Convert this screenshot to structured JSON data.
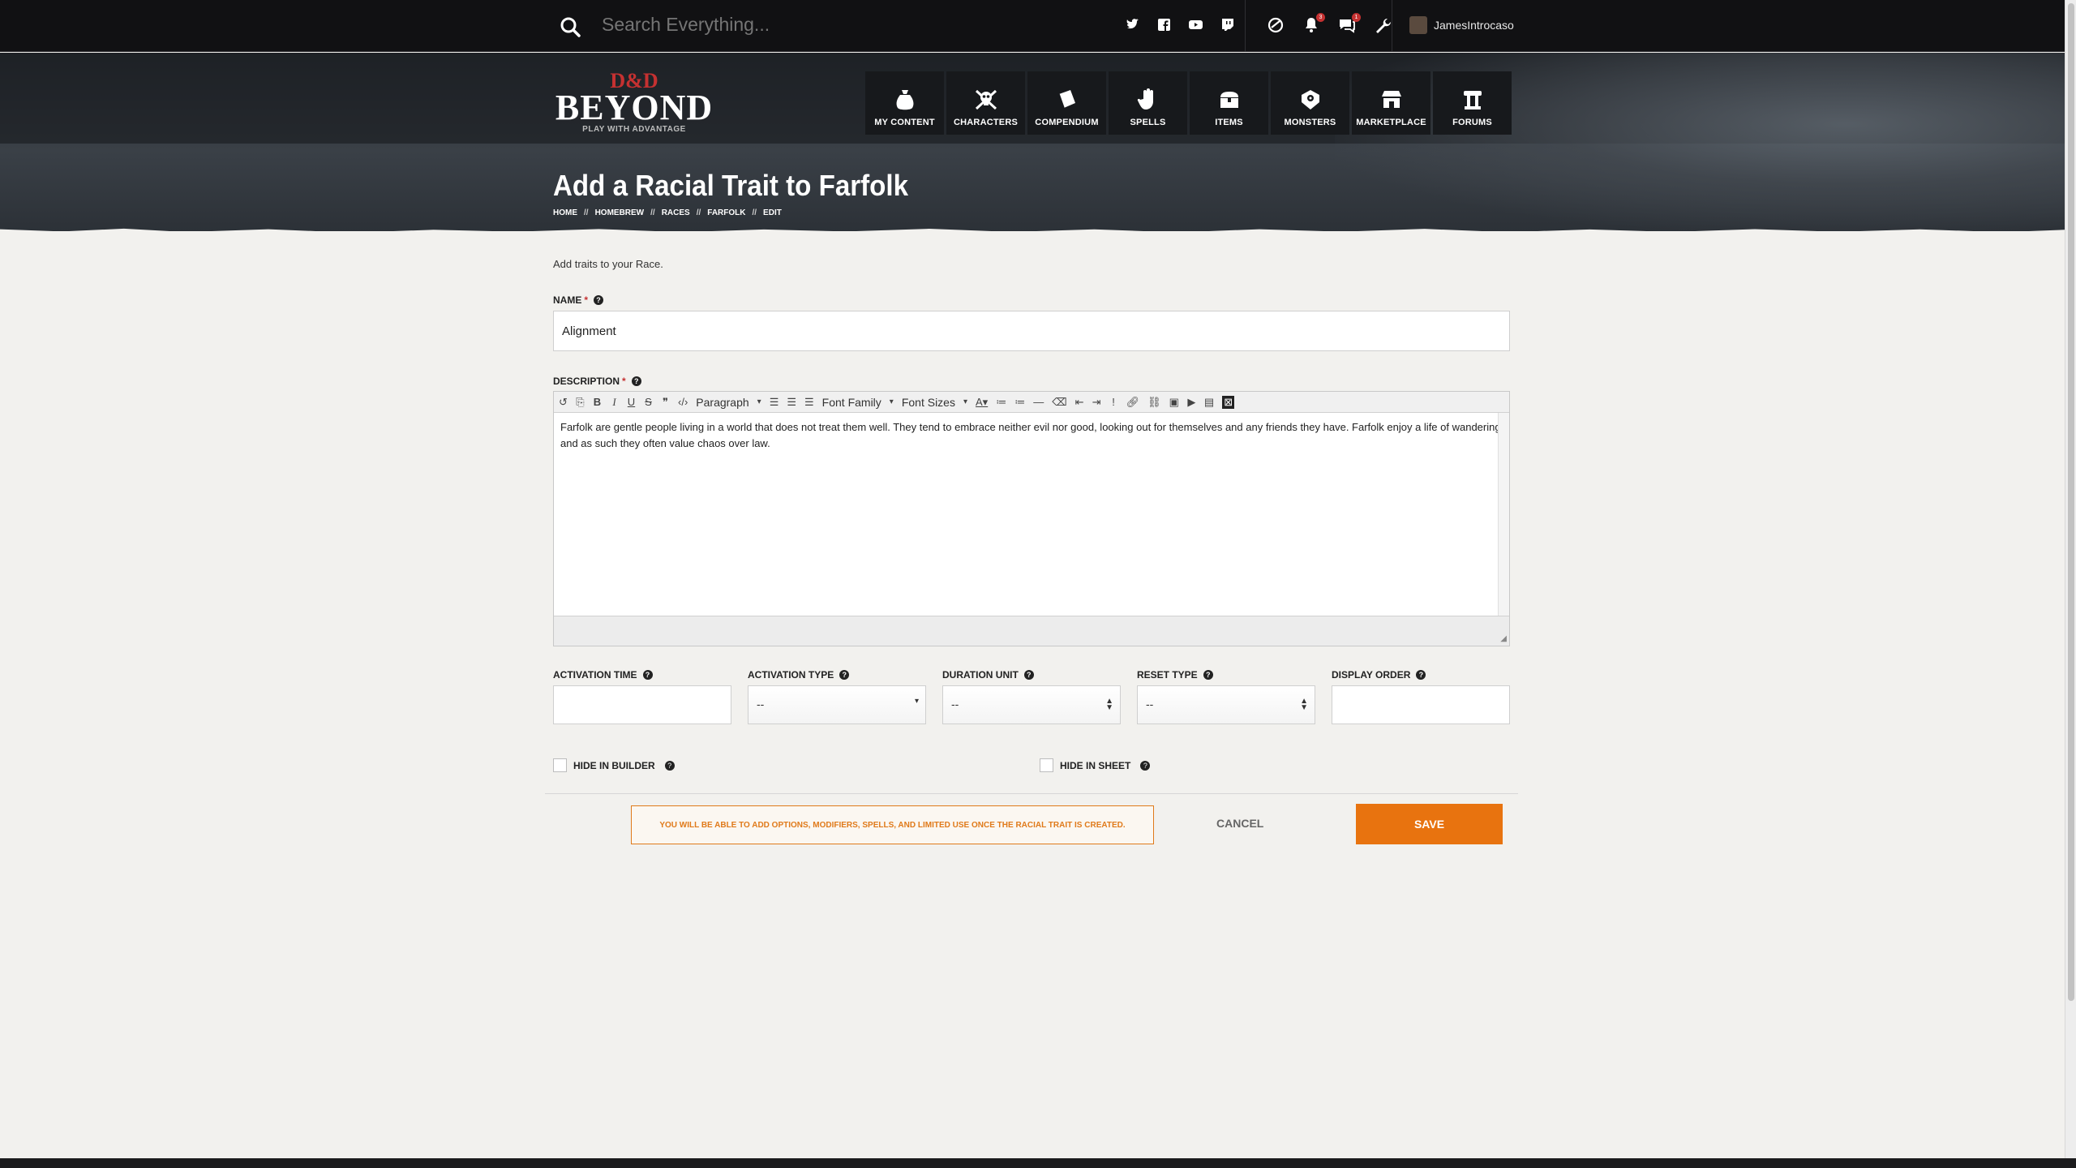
{
  "search": {
    "placeholder": "Search Everything..."
  },
  "social_icons": [
    "twitter-icon",
    "facebook-icon",
    "youtube-icon",
    "twitch-icon"
  ],
  "top_icons": [
    "dnd-icon",
    "notifications-icon",
    "messages-icon",
    "wrench-icon"
  ],
  "notifications": {
    "badge": "3"
  },
  "messages": {
    "badge": "1"
  },
  "user": {
    "name": "JamesIntrocaso"
  },
  "logo": {
    "dd": "D&D",
    "beyond": "BEYOND",
    "tagline": "PLAY WITH ADVANTAGE"
  },
  "nav": [
    {
      "label": "MY CONTENT",
      "icon": "bag-icon"
    },
    {
      "label": "CHARACTERS",
      "icon": "skull-crossbones-icon"
    },
    {
      "label": "COMPENDIUM",
      "icon": "book-icon"
    },
    {
      "label": "SPELLS",
      "icon": "hand-icon"
    },
    {
      "label": "ITEMS",
      "icon": "chest-icon"
    },
    {
      "label": "MONSTERS",
      "icon": "monster-icon"
    },
    {
      "label": "MARKETPLACE",
      "icon": "store-icon"
    },
    {
      "label": "FORUMS",
      "icon": "forum-icon"
    }
  ],
  "page": {
    "title": "Add a Racial Trait to Farfolk",
    "breadcrumb": [
      "HOME",
      "HOMEBREW",
      "RACES",
      "FARFOLK",
      "EDIT"
    ],
    "breadcrumb_sep": "//"
  },
  "form": {
    "intro": "Add traits to your Race.",
    "name_label": "NAME",
    "name_value": "Alignment",
    "description_label": "DESCRIPTION",
    "required_mark": "*",
    "help_mark": "?",
    "toolbar": {
      "paragraph": "Paragraph",
      "font_family": "Font Family",
      "font_sizes": "Font Sizes"
    },
    "description_text": "Farfolk are gentle people living in a world that does not treat them well. They tend to embrace neither evil nor good, looking out for themselves and any friends they have. Farfolk enjoy a life of wandering and as such they often value chaos over law.",
    "fields": [
      {
        "label": "ACTIVATION TIME",
        "value": ""
      },
      {
        "label": "ACTIVATION TYPE",
        "value": "--"
      },
      {
        "label": "DURATION UNIT",
        "value": "--"
      },
      {
        "label": "RESET TYPE",
        "value": "--"
      },
      {
        "label": "DISPLAY ORDER",
        "value": ""
      }
    ],
    "hide_in_builder": "HIDE IN BUILDER",
    "hide_in_sheet": "HIDE IN SHEET",
    "notice": "YOU WILL BE ABLE TO ADD OPTIONS, MODIFIERS, SPELLS, AND LIMITED USE ONCE THE RACIAL TRAIT IS CREATED.",
    "cancel": "CANCEL",
    "save": "SAVE"
  },
  "colors": {
    "accent": "#e8730f",
    "brand_red": "#c53131",
    "topbar": "#111113"
  }
}
